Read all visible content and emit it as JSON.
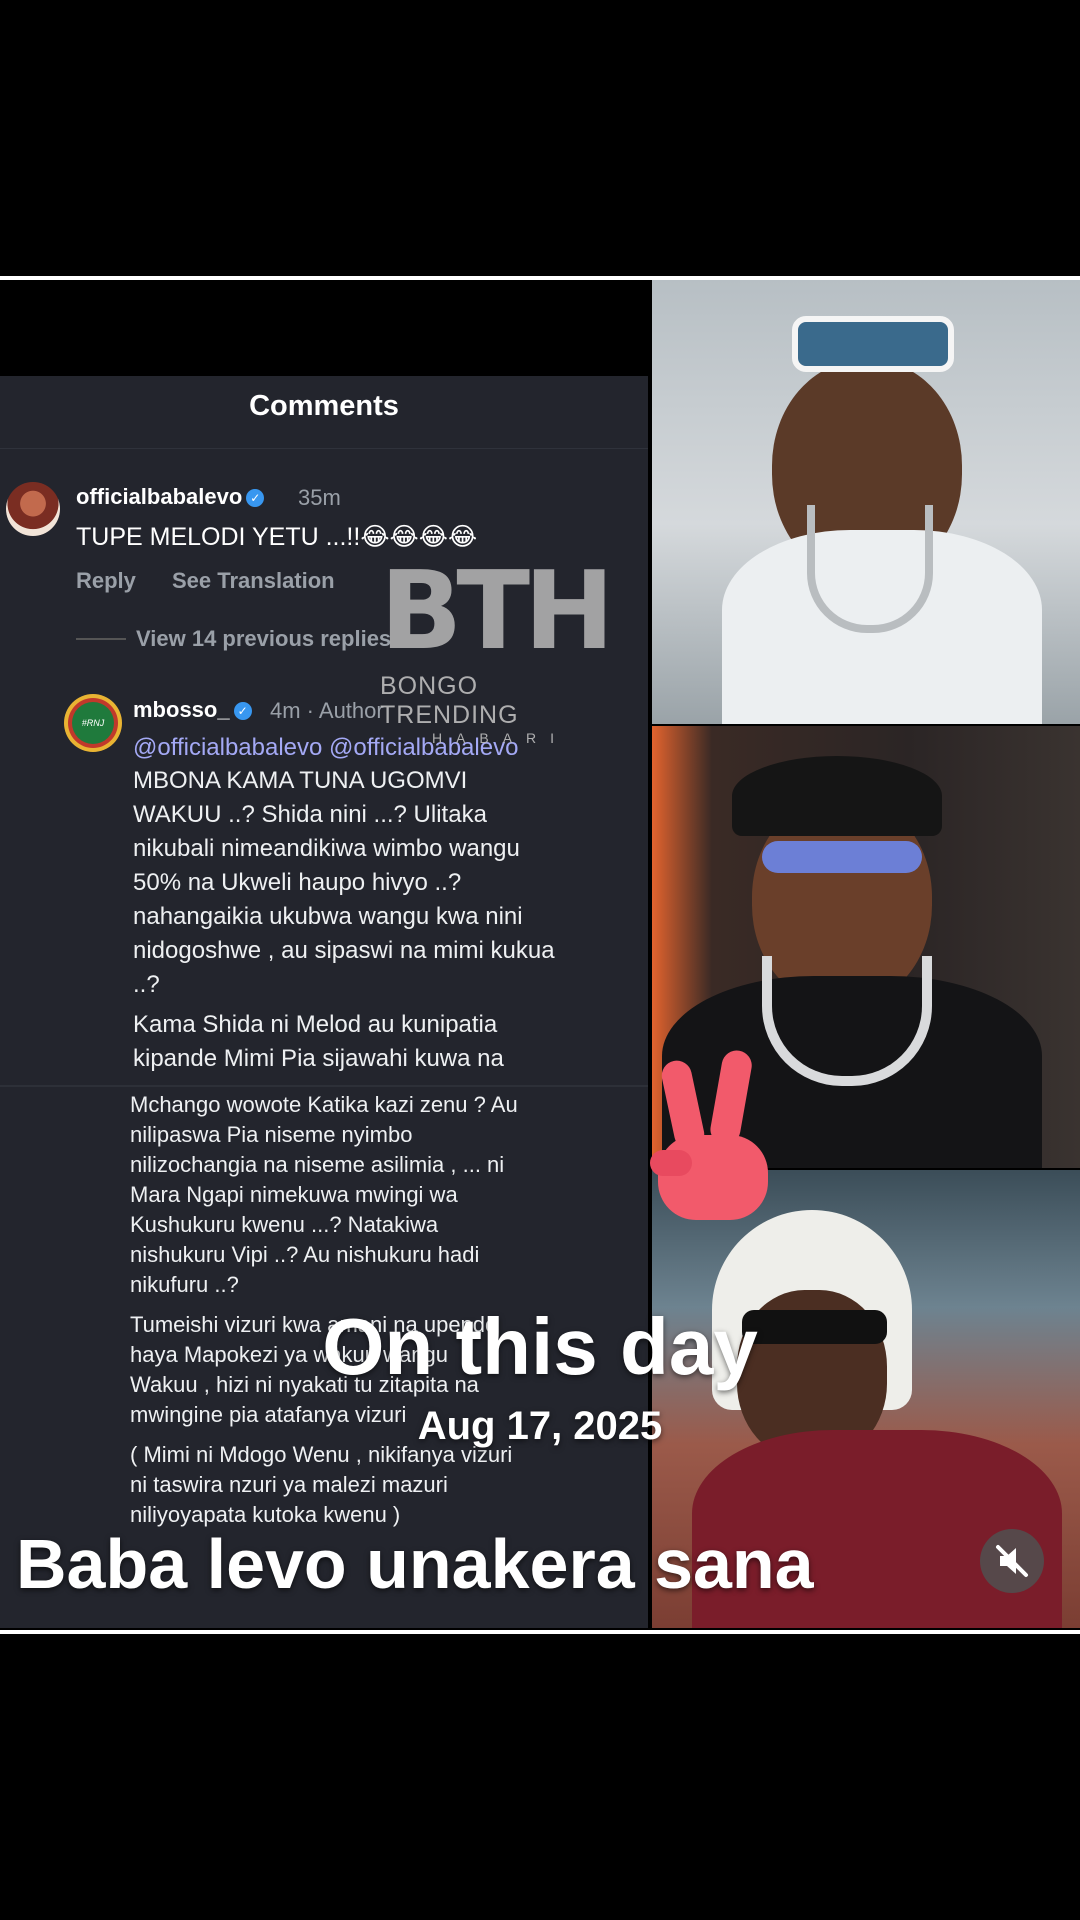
{
  "comments_title": "Comments",
  "comment1": {
    "username": "officialbabalevo",
    "time": "35m",
    "text": "TUPE MELODI YETU ...!!",
    "emojis": "😂😂😂😂",
    "reply": "Reply",
    "see_translation": "See Translation",
    "view_previous": "View 14 previous replies"
  },
  "comment2": {
    "username": "mbosso_",
    "avatar_text": "#RNJ",
    "meta": "4m · Author",
    "mentions": "@officialbabalevo @officialbabalevo",
    "body1": "MBONA KAMA TUNA UGOMVI\nWAKUU ..? Shida nini ...? Ulitaka\nnikubali nimeandikiwa wimbo wangu\n50% na Ukweli haupo hivyo ..?\nnahangaikia ukubwa wangu kwa nini\nnidogoshwe , au sipaswi na mimi kukua\n..?",
    "body2": "Kama Shida ni Melod au kunipatia\nkipande Mimi Pia sijawahi kuwa na",
    "body3": "Mchango wowote Katika kazi zenu ? Au\nnilipaswa Pia niseme nyimbo\nnilizochangia na niseme asilimia , ... ni\nMara Ngapi nimekuwa mwingi wa\nKushukuru kwenu ...? Natakiwa\nnishukuru Vipi ..? Au nishukuru hadi\nnikufuru ..?",
    "body4": "Tumeishi vizuri kwa amani na upendo\nhaya Mapokezi ya wakuu wangu\nWakuu , hizi ni nyakati tu zitapita na\nmwingine pia atafanya vizuri",
    "body5": "( Mimi ni Mdogo Wenu , nikifanya vizuri\nni taswira nzuri ya malezi mazuri\nniliyoyapata kutoka kwenu )"
  },
  "watermark": {
    "logo": "BTH",
    "line1": "BONGO TRENDING",
    "line2": "HABARI"
  },
  "overlay": {
    "title": "On this day",
    "date": "Aug 17, 2025",
    "caption": "Baba levo unakera sana"
  },
  "icons": {
    "mute": "speaker-muted-icon",
    "verified": "verified-badge-icon",
    "peace": "victory-hand-icon"
  },
  "colors": {
    "panel_bg": "#23252d",
    "mention": "#a4a9f5",
    "verified": "#3897f0",
    "peace": "#f25a6b"
  }
}
